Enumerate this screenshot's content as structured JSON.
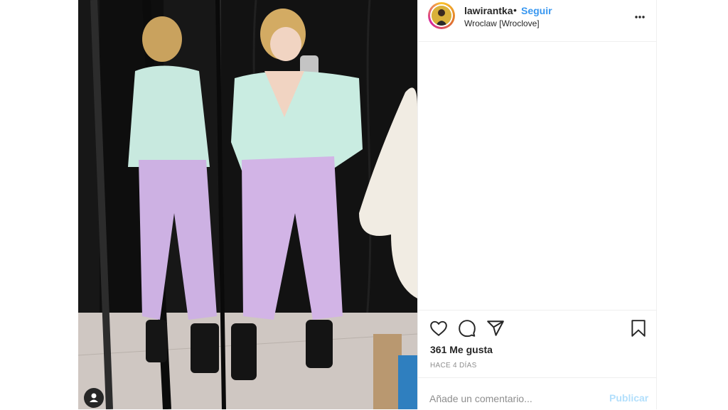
{
  "post": {
    "username": "lawirantka",
    "separator": "•",
    "follow_label": "Seguir",
    "location": "Wroclaw [Wroclove]"
  },
  "actions": {
    "icons": [
      "heart-icon",
      "comment-icon",
      "share-icon",
      "bookmark-icon"
    ]
  },
  "stats": {
    "likes": "361 Me gusta",
    "time": "HACE 4 DÍAS"
  },
  "comment": {
    "placeholder": "Añade un comentario...",
    "publish_label": "Publicar"
  },
  "colors": {
    "link": "#3897f0",
    "publish_disabled": "#b2dffc",
    "text": "#262626",
    "muted": "#8e8e8e",
    "divider": "#efefef"
  }
}
